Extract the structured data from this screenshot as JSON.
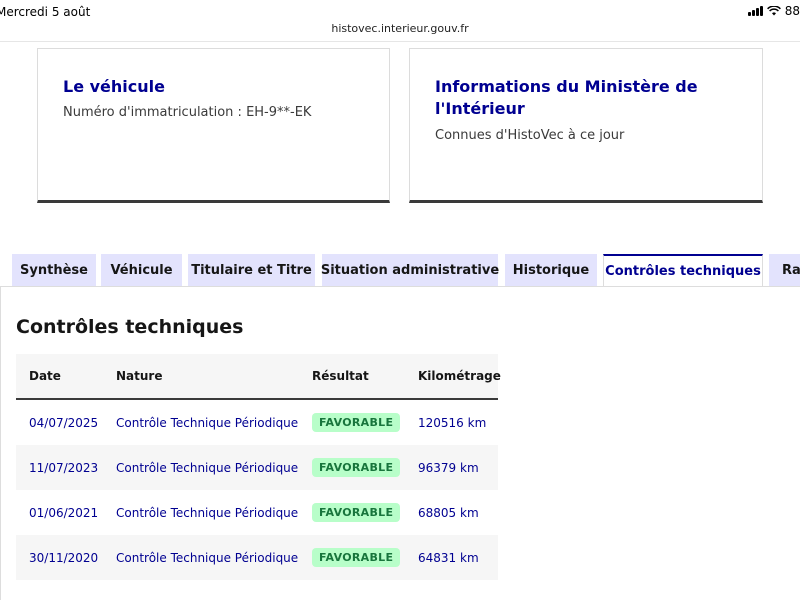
{
  "status_bar": {
    "date": "Mercredi 5 août",
    "battery": "88"
  },
  "browser": {
    "url": "histovec.interieur.gouv.fr"
  },
  "cards": {
    "vehicle": {
      "title": "Le véhicule",
      "text": "Numéro d'immatriculation : EH-9**-EK"
    },
    "ministere": {
      "title": "Informations du Ministère de l'Intérieur",
      "text": "Connues d'HistoVec à ce jour"
    }
  },
  "tabs": [
    {
      "label": "Synthèse",
      "active": false
    },
    {
      "label": "Véhicule",
      "active": false
    },
    {
      "label": "Titulaire et Titre",
      "active": false
    },
    {
      "label": "Situation administrative",
      "active": false
    },
    {
      "label": "Historique",
      "active": false
    },
    {
      "label": "Contrôles techniques",
      "active": true
    },
    {
      "label": "Rap",
      "active": false
    }
  ],
  "section": {
    "title": "Contrôles techniques"
  },
  "table": {
    "headers": {
      "date": "Date",
      "nature": "Nature",
      "result": "Résultat",
      "km": "Kilométrage"
    },
    "rows": [
      {
        "date": "04/07/2025",
        "nature": "Contrôle Technique Périodique",
        "result": "FAVORABLE",
        "km": "120516 km"
      },
      {
        "date": "11/07/2023",
        "nature": "Contrôle Technique Périodique",
        "result": "FAVORABLE",
        "km": "96379 km"
      },
      {
        "date": "01/06/2021",
        "nature": "Contrôle Technique Périodique",
        "result": "FAVORABLE",
        "km": "68805 km"
      },
      {
        "date": "30/11/2020",
        "nature": "Contrôle Technique Périodique",
        "result": "FAVORABLE",
        "km": "64831 km"
      }
    ]
  },
  "colors": {
    "accent": "#000091",
    "tab_inactive_bg": "#e3e3fd",
    "badge_bg": "#b8fec9",
    "badge_text": "#18753c"
  }
}
